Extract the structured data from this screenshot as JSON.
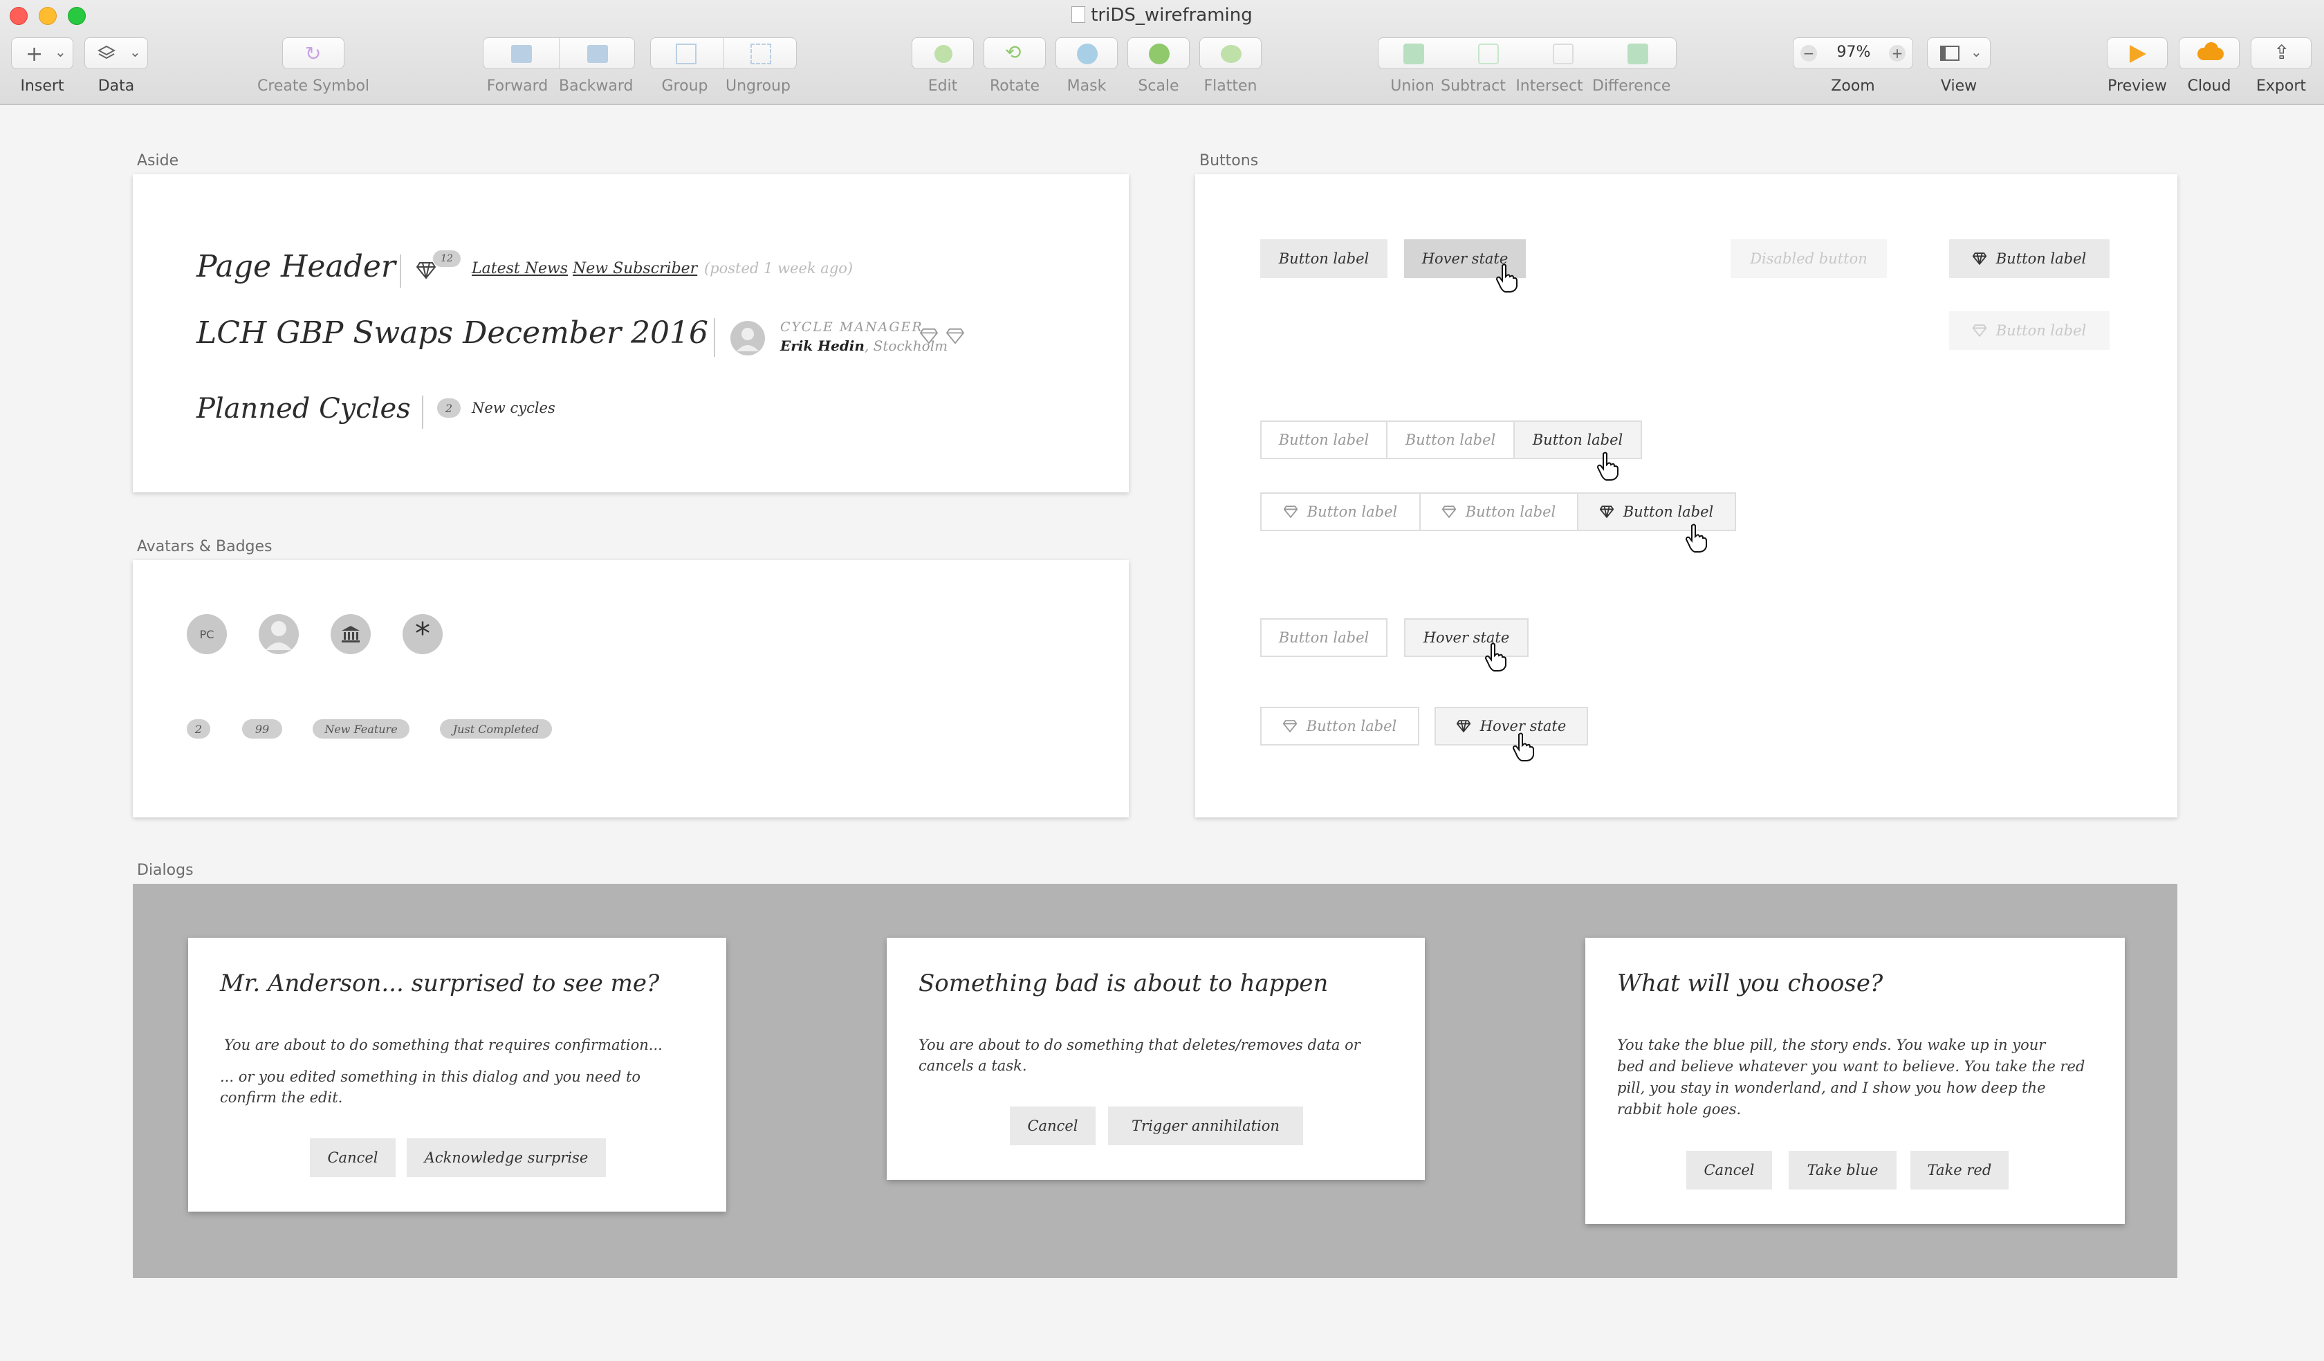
{
  "window": {
    "title": "triDS_wireframing"
  },
  "toolbar": {
    "insert": "Insert",
    "data": "Data",
    "create_symbol": "Create Symbol",
    "forward": "Forward",
    "backward": "Backward",
    "group": "Group",
    "ungroup": "Ungroup",
    "edit": "Edit",
    "rotate": "Rotate",
    "mask": "Mask",
    "scale": "Scale",
    "flatten": "Flatten",
    "union": "Union",
    "subtract": "Subtract",
    "intersect": "Intersect",
    "difference": "Difference",
    "zoom_value": "97%",
    "zoom": "Zoom",
    "view": "View",
    "preview": "Preview",
    "cloud": "Cloud",
    "export": "Export"
  },
  "aside": {
    "section_title": "Aside",
    "page_header": "Page Header",
    "badge_count": "12",
    "link_news": "Latest News",
    "link_subscriber": "New Subscriber",
    "posted": "(posted 1 week ago)",
    "heading2": "LCH GBP Swaps December 2016",
    "role": "CYCLE MANAGER",
    "person_name": "Erik Hedin",
    "person_city": ", Stockholm",
    "heading3": "Planned Cycles",
    "cycles_count": "2",
    "cycles_label": "New cycles"
  },
  "avatars": {
    "section_title": "Avatars & Badges",
    "initials": "PC",
    "badges": [
      "2",
      "99",
      "New Feature",
      "Just Completed"
    ]
  },
  "buttons": {
    "section_title": "Buttons",
    "label": "Button label",
    "hover": "Hover state",
    "disabled": "Disabled button"
  },
  "dialogs": {
    "section_title": "Dialogs",
    "d1": {
      "title": "Mr. Anderson... surprised to see me?",
      "line1": "You are about to do something that requires confirmation...",
      "line2": "... or you edited something in this dialog and you need to",
      "line3": "confirm the edit.",
      "cancel": "Cancel",
      "confirm": "Acknowledge surprise"
    },
    "d2": {
      "title": "Something bad is about to happen",
      "line1": "You are about to do something that deletes/removes data or",
      "line2": "cancels a task.",
      "cancel": "Cancel",
      "confirm": "Trigger annihilation"
    },
    "d3": {
      "title": "What will you choose?",
      "line1": "You take the blue pill, the story ends. You wake up in your",
      "line2": "bed and believe whatever you want to believe. You take the red",
      "line3": "pill, you stay in wonderland, and I show you how deep the",
      "line4": "rabbit hole goes.",
      "cancel": "Cancel",
      "blue": "Take blue",
      "red": "Take red"
    }
  },
  "colors": {
    "close": "#ff5f57",
    "minimize": "#febc2e",
    "zoom": "#28c840",
    "overlay": "#b3b3b3",
    "preview": "#f5a623",
    "cloud": "#f39c12"
  }
}
